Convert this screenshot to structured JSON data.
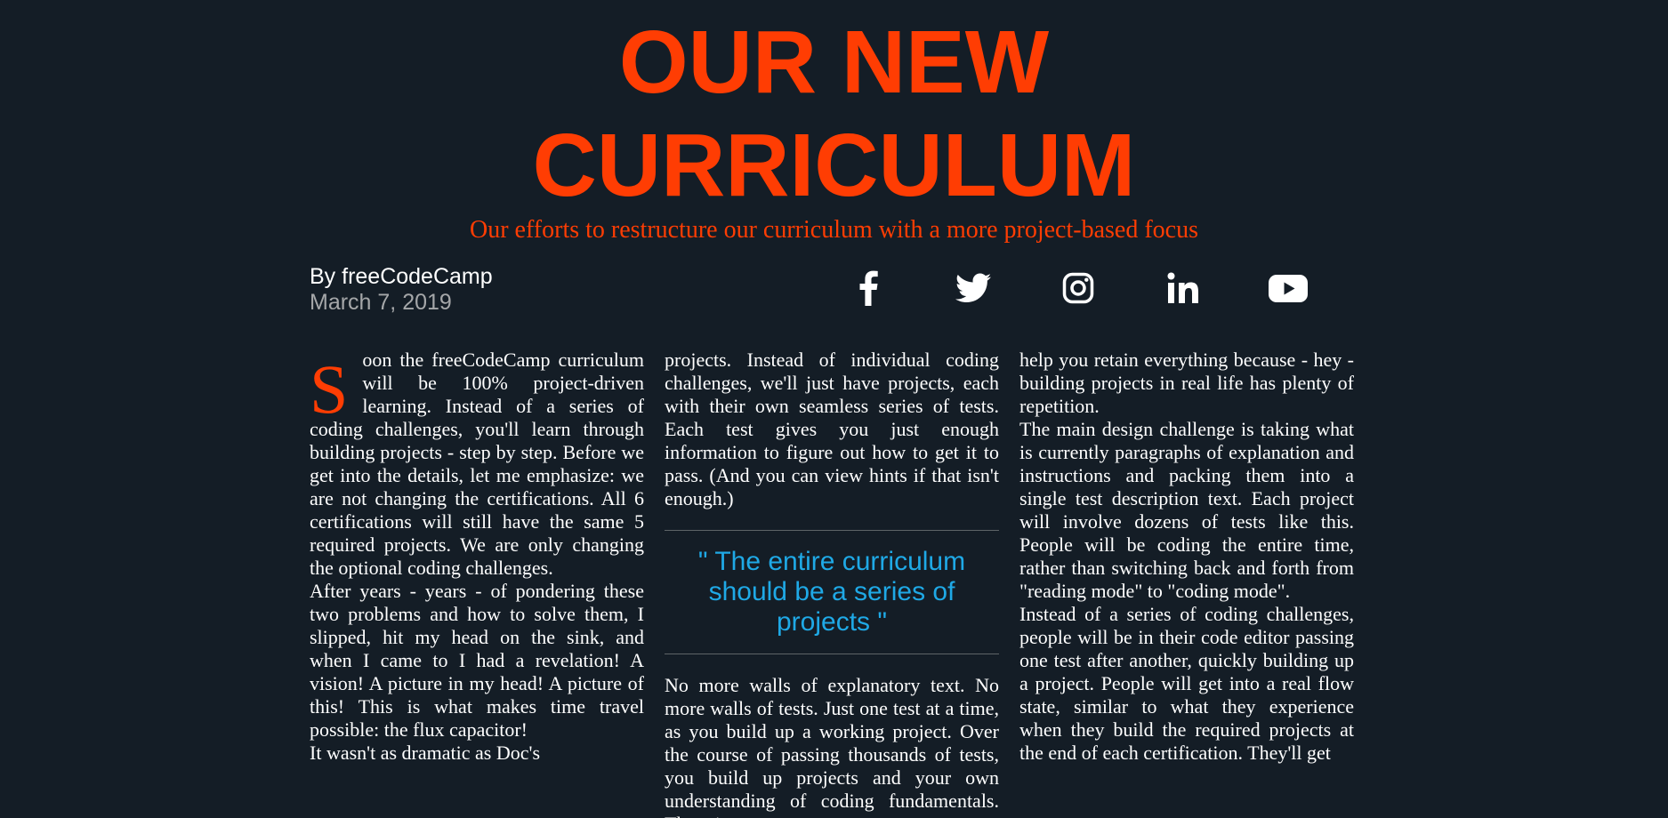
{
  "header": {
    "title_line1": "OUR NEW",
    "title_line2": "CURRICULUM",
    "subtitle": "Our efforts to restructure our curriculum with a more project-based focus",
    "author": "By freeCodeCamp",
    "date": "March 7, 2019"
  },
  "social": {
    "icons": [
      "facebook-icon",
      "twitter-icon",
      "instagram-icon",
      "linkedin-icon",
      "youtube-icon"
    ]
  },
  "article": {
    "col1": {
      "dropcap": "S",
      "p1_rest": "oon the freeCodeCamp curriculum will be 100% project-driven learning. Instead of a series of coding challenges, you'll learn through building projects - step by step. Before we get into the details, let me emphasize: we are not changing the certifications. All 6 certifications will still have the same 5 required projects. We are only changing the optional coding challenges.",
      "p2": "After years - years - of pondering these two problems and how to solve them, I slipped, hit my head on the sink, and when I came to I had a revelation! A vision! A picture in my head! A picture of this! This is what makes time travel possible: the flux capacitor!",
      "p3": "It wasn't as dramatic as Doc's"
    },
    "col2": {
      "p1": "projects. Instead of individual coding challenges, we'll just have projects, each with their own seamless series of tests. Each test gives you just enough information to figure out how to get it to pass. (And you can view hints if that isn't enough.)",
      "quote": "\" The entire curriculum should be a series of projects \"",
      "p2": "No more walls of explanatory text. No more walls of tests. Just one test at a time, as you build up a working project. Over the course of passing thousands of tests, you build up projects and your own understanding of coding fundamentals. There is"
    },
    "col3": {
      "p1": "help you retain everything because - hey - building projects in real life has plenty of repetition.",
      "p2": "The main design challenge is taking what is currently paragraphs of explanation and instructions and packing them into a single test description text. Each project will involve dozens of tests like this. People will be coding the entire time, rather than switching back and forth from \"reading mode\" to \"coding mode\".",
      "p3": "Instead of a series of coding challenges, people will be in their code editor passing one test after another, quickly building up a project. People will get into a real flow state, similar to what they experience when they build the required projects at the end of each certification. They'll get"
    }
  },
  "colors": {
    "background": "#141d26",
    "accent": "#ff3d03",
    "quote": "#1fa9e6",
    "muted": "#a5a7a9"
  }
}
